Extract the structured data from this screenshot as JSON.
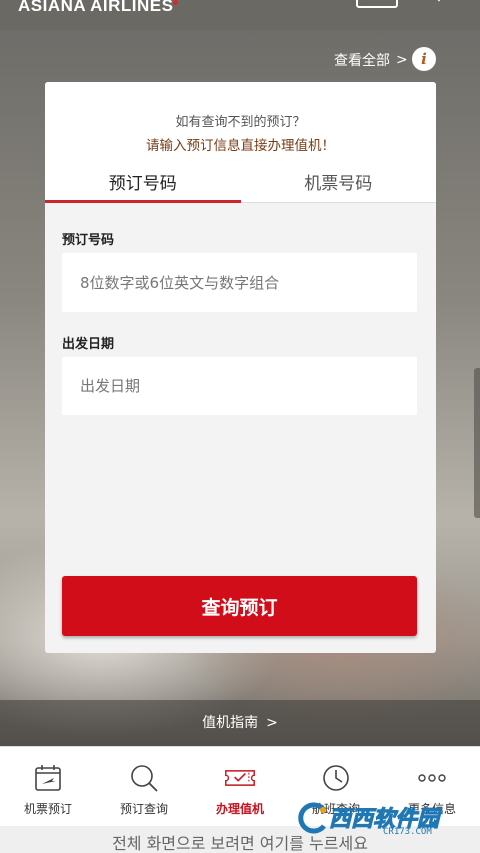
{
  "header": {
    "brand": "ASIANA AIRLINES",
    "view_all": "查看全部",
    "view_all_chevron": ">",
    "info_icon": "i"
  },
  "card": {
    "notice_line1": "如有查询不到的预订？",
    "notice_line2": "请输入预订信息直接办理值机！",
    "tabs": [
      {
        "label": "预订号码",
        "active": true
      },
      {
        "label": "机票号码",
        "active": false
      }
    ],
    "booking_label": "预订号码",
    "booking_placeholder": "8位数字或6位英文与数字组合",
    "date_label": "出发日期",
    "date_placeholder": "出发日期",
    "submit_label": "查询预订"
  },
  "guide": {
    "label": "值机指南",
    "chevron": ">"
  },
  "bottom_nav": [
    {
      "label": "机票预订",
      "icon": "plane-calendar-icon",
      "active": false
    },
    {
      "label": "预订查询",
      "icon": "search-icon",
      "active": false
    },
    {
      "label": "办理值机",
      "icon": "checkin-ticket-icon",
      "active": true
    },
    {
      "label": "航班查询",
      "icon": "clock-icon",
      "active": false
    },
    {
      "label": "更多信息",
      "icon": "more-dots-icon",
      "active": false
    }
  ],
  "footer": {
    "text": "전체 화면으로 보려면 여기를 누르세요"
  },
  "watermark": {
    "text": "西西软件园",
    "url": "CR173.COM"
  },
  "colors": {
    "accent_red": "#d10d1a",
    "notice_brown": "#7a3b14",
    "watermark_blue": "#1f77b4"
  }
}
